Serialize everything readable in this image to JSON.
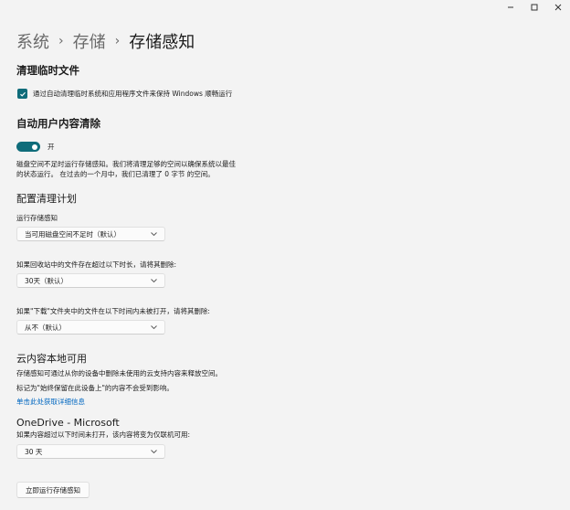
{
  "breadcrumb": [
    "系统",
    "存储",
    "存储感知"
  ],
  "sections": {
    "temp_files": {
      "title": "清理临时文件",
      "checkbox_label": "通过自动清理临时系统和应用程序文件来保持 Windows 顺畅运行",
      "checked": true
    },
    "auto_cleanup": {
      "title": "自动用户内容清除",
      "toggle_label": "开",
      "toggle_on": true,
      "description_line1": "磁盘空间不足时运行存储感知。我们将清理足够的空间以确保系统以最佳",
      "description_line2": "的状态运行。 在过去的一个月中，我们已清理了 0 字节 的空间。"
    },
    "schedule": {
      "title": "配置清理计划",
      "run_label": "运行存储感知",
      "run_value": "当可用磁盘空间不足时（默认）",
      "recycle_label": "如果回收站中的文件存在超过以下时长，请将其删除:",
      "recycle_value": "30天（默认）",
      "downloads_label": "如果\"下载\"文件夹中的文件在以下时间内未被打开，请将其删除:",
      "downloads_value": "从不（默认）"
    },
    "cloud": {
      "title": "云内容本地可用",
      "line1": "存储感知可通过从你的设备中删除未使用的云支持内容来释放空间。",
      "line2": "标记为\"始终保留在此设备上\"的内容不会受到影响。",
      "link": "单击此处获取详细信息"
    },
    "onedrive": {
      "title": "OneDrive - Microsoft",
      "label": "如果内容超过以下时间未打开，该内容将变为仅联机可用:",
      "value": "30 天"
    }
  },
  "actions": {
    "run_now": "立即运行存储感知"
  },
  "colors": {
    "accent": "#0f6c7a",
    "link": "#0067c0",
    "background": "#f3f3f3"
  },
  "icons": [
    "minimize-icon",
    "maximize-icon",
    "close-icon",
    "check-icon",
    "chevron-right-icon",
    "chevron-down-icon"
  ]
}
